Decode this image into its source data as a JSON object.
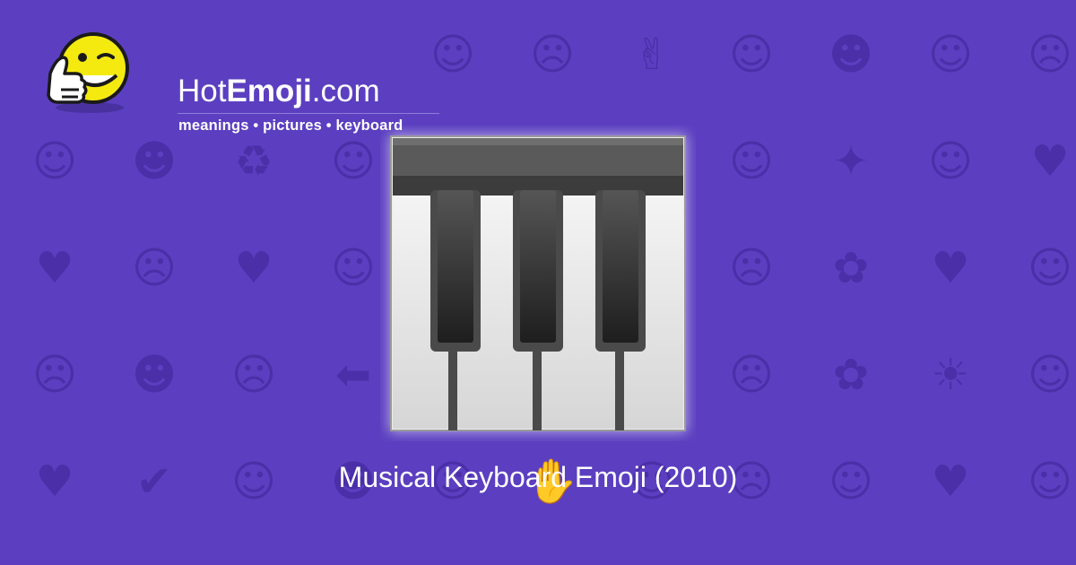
{
  "site": {
    "title_prefix": "Hot",
    "title_bold": "Emoji",
    "title_suffix": ".com",
    "tagline": "meanings • pictures • keyboard"
  },
  "emoji": {
    "name": "Musical Keyboard Emoji (2010)",
    "icon": "musical-keyboard-icon"
  },
  "theme": {
    "background": "#5b3fc0",
    "pattern_color": "#4a2fa8",
    "text": "#ffffff",
    "mascot_yellow": "#f5ea10"
  },
  "background_pattern": [
    "☺",
    "☻",
    "☹",
    "♥",
    "☺",
    "☹",
    "✌",
    "☺",
    "☻",
    "☺",
    "☹",
    "☺",
    "☻",
    "♻",
    "☺",
    "♫",
    "☺",
    "☹",
    "☺",
    "✦",
    "☺",
    "♥",
    "♥",
    "☹",
    "♥",
    "☺",
    "☹",
    "☺",
    "♥",
    "☹",
    "✿",
    "♥",
    "☺",
    "☹",
    "☻",
    "☹",
    "⬅",
    "☺",
    "☺",
    "☻",
    "☹",
    "✿",
    "☀",
    "☺",
    "♥",
    "✔",
    "☺",
    "☻",
    "☺",
    "✋",
    "☺",
    "☹",
    "☺",
    "♥",
    "☺"
  ]
}
